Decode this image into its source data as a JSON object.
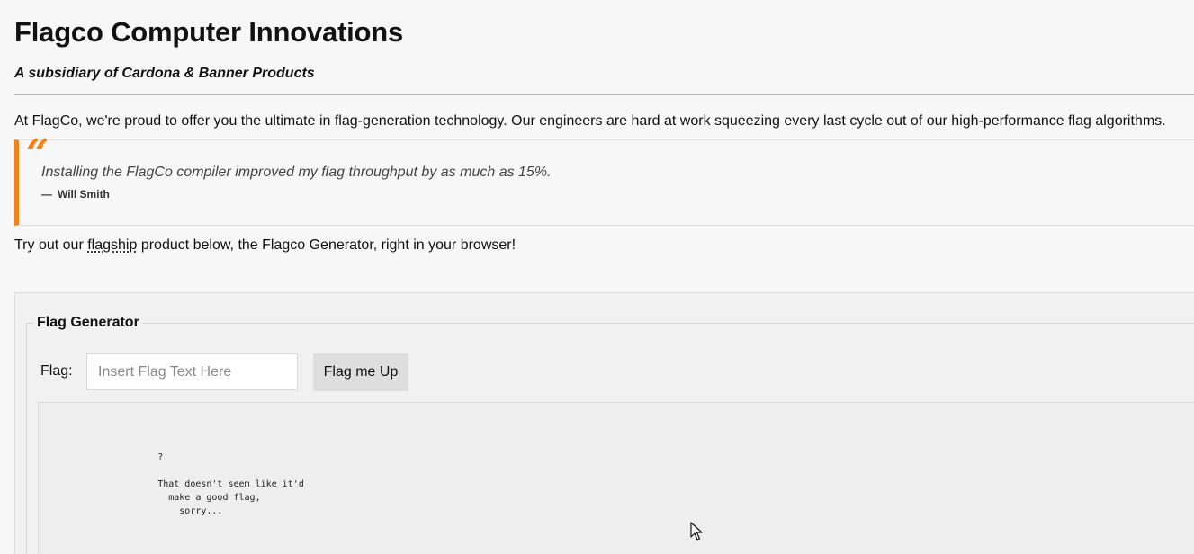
{
  "header": {
    "title": "Flagco Computer Innovations",
    "subtitle": "A subsidiary of Cardona & Banner Products"
  },
  "intro": {
    "text": "At FlagCo, we're proud to offer you the ultimate in flag-generation technology. Our engineers are hard at work squeezing every last cycle out of our high-performance flag algorithms."
  },
  "testimonial": {
    "quote_mark": "“",
    "text": "Installing the FlagCo compiler improved my flag throughput by as much as 15%.",
    "dash": "—",
    "author": "Will Smith"
  },
  "tryout": {
    "before": "Try out our ",
    "link": "flagship",
    "after": " product below, the Flagco Generator, right in your browser!"
  },
  "generator": {
    "legend": "Flag Generator",
    "flag_label": "Flag:",
    "input_value": "",
    "input_placeholder": "Insert Flag Text Here",
    "button_label": "Flag me Up",
    "output": "          ?\n\n          That doesn't seem like it'd\n            make a good flag,\n              sorry..."
  },
  "colors": {
    "accent": "#f58216",
    "background": "#f7f7f7",
    "panel": "#f1f1f1"
  },
  "icons": {
    "quote": "quote-icon",
    "cursor": "mouse-cursor-icon"
  }
}
